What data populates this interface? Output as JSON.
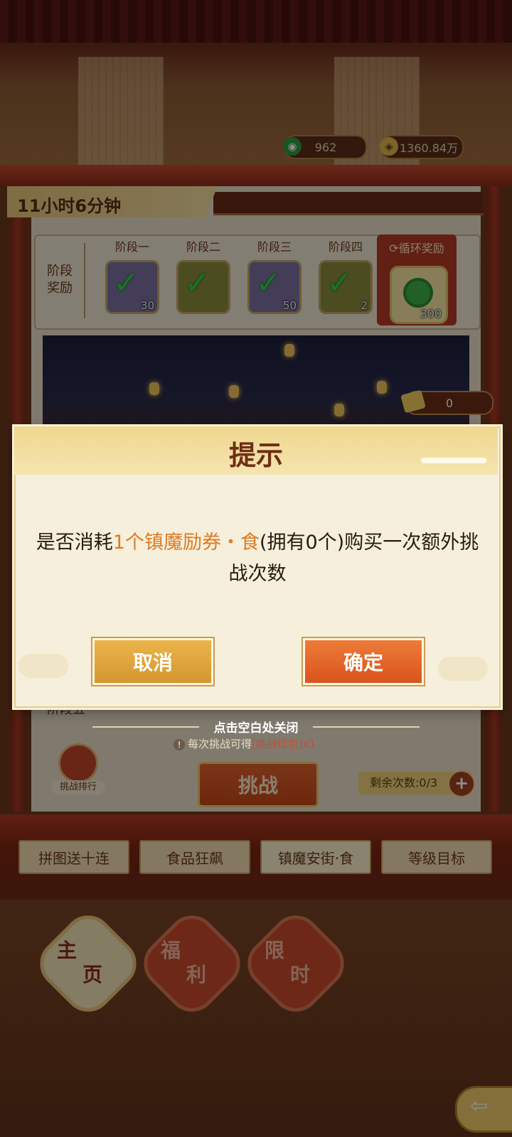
{
  "currency": {
    "jade_amount": "962",
    "coin_amount": "1360.84万"
  },
  "timer": "11小时6分钟",
  "stage_rewards": {
    "label": "阶段\n奖励",
    "stages": [
      {
        "title": "阶段一",
        "qty": "30",
        "done": true
      },
      {
        "title": "阶段二",
        "qty": "",
        "done": true
      },
      {
        "title": "阶段三",
        "qty": "50",
        "done": true
      },
      {
        "title": "阶段四",
        "qty": "2",
        "done": true
      }
    ],
    "loop": {
      "title": "循环奖励",
      "qty": "300"
    }
  },
  "ticket_count": "0",
  "stage5_label": "阶段五",
  "close_hint": "点击空白处关闭",
  "reward_note": {
    "prefix": "每次挑战可得",
    "item": "[挑战红包]x1"
  },
  "rank_label": "挑战排行",
  "challenge_label": "挑战",
  "remaining": "剩余次数:0/3",
  "tabs": [
    "拼图送十连",
    "食品狂飙",
    "镇魔安街·食",
    "等级目标"
  ],
  "nav": [
    {
      "chars": [
        "主",
        "页"
      ]
    },
    {
      "chars": [
        "福",
        "利"
      ]
    },
    {
      "chars": [
        "限",
        "时"
      ]
    }
  ],
  "dialog": {
    "title": "提示",
    "msg_pre": "是否消耗",
    "msg_highlight": "1个镇魔励券・食",
    "msg_post": "(拥有0个)购买一次额外挑战次数",
    "cancel": "取消",
    "confirm": "确定"
  },
  "colors": {
    "accent_orange": "#e07a24",
    "confirm": "#d9541c",
    "cancel": "#d6962f"
  }
}
